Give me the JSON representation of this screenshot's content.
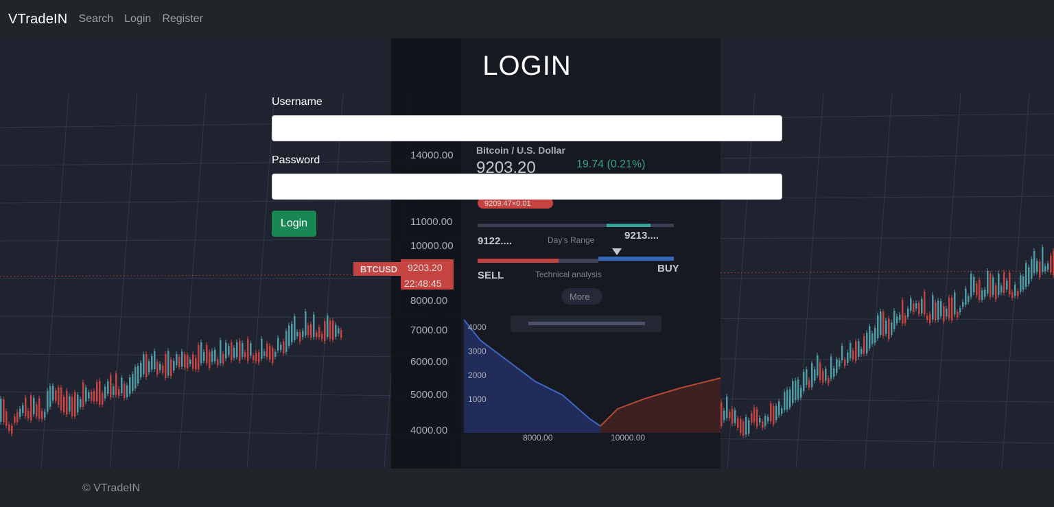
{
  "navbar": {
    "brand": "VTradeIN",
    "links": [
      "Search",
      "Login",
      "Register"
    ]
  },
  "login": {
    "title": "LOGIN",
    "username_label": "Username",
    "password_label": "Password",
    "username_value": "",
    "password_value": "",
    "button_label": "Login"
  },
  "background": {
    "price_ticks": [
      "14000.00",
      "11000.00",
      "10000.00",
      "8000.00",
      "7000.00",
      "6000.00",
      "5000.00",
      "4000.00"
    ],
    "ticker": "BTCUSD",
    "ticker_price": "9203.20",
    "ticker_time": "22:48:45",
    "pair_name": "Bitcoin / U.S. Dollar",
    "pair_price": "9203.20",
    "pair_change": "19.74 (0.21%)",
    "low_tag": "9209.47×0.01",
    "range_low": "9122....",
    "range_label": "Day's Range",
    "range_high": "9213....",
    "sell_label": "SELL",
    "analysis_label": "Technical analysis",
    "buy_label": "BUY",
    "more_label": "More",
    "depth_ticks": [
      "4000",
      "3000",
      "2000",
      "1000"
    ],
    "depth_x_ticks": [
      "8000.00",
      "10000.00"
    ],
    "colors": {
      "up": "#5fb6c2",
      "down": "#e8514e",
      "accent": "#198754"
    }
  },
  "footer": {
    "text": "© VTradeIN"
  }
}
